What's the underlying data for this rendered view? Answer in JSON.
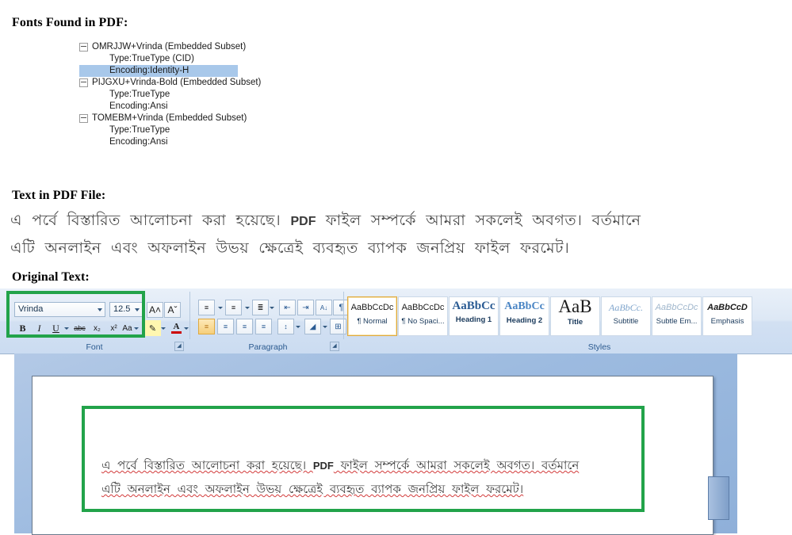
{
  "sections": {
    "fonts_heading": "Fonts Found in PDF:",
    "pdf_text_heading": "Text in PDF File:",
    "original_text_heading": "Original Text:"
  },
  "font_tree": [
    {
      "name": "OMRJJW+Vrinda (Embedded Subset)",
      "type": "Type:TrueType (CID)",
      "encoding": "Encoding:Identity-H",
      "encoding_selected": true
    },
    {
      "name": "PIJGXU+Vrinda-Bold (Embedded Subset)",
      "type": "Type:TrueType",
      "encoding": "Encoding:Ansi",
      "encoding_selected": false
    },
    {
      "name": "TOMEBM+Vrinda (Embedded Subset)",
      "type": "Type:TrueType",
      "encoding": "Encoding:Ansi",
      "encoding_selected": false
    }
  ],
  "pdf_text": {
    "line1_a": "এ পর্বে বিস্তারিত আলোচনা করা হয়েছে। ",
    "line1_latin": "PDF",
    "line1_b": " ফাইল সম্পর্কে আমরা সকলেই অবগত।  বর্তমানে",
    "line2": "এটি অনলাইন এবং অফলাইন উভয় ক্ষেত্রেই ব্যবহৃত ব্যাপক জনপ্রিয় ফাইল ফরমেট।"
  },
  "document_text": {
    "line1_a": "এ পর্বে বিস্তারিত আলোচনা করা হয়েছে। ",
    "line1_latin": "PDF",
    "line1_b": " ফাইল সম্পর্কে আমরা সকলেই অবগত।  বর্তমানে",
    "line2": "এটি অনলাইন এবং অফলাইন উভয় ক্ষেত্রেই ব্যবহৃত ব্যাপক জনপ্রিয় ফাইল ফরমেট।"
  },
  "ribbon": {
    "font_group": {
      "label": "Font",
      "font_name": "Vrinda",
      "font_size": "12.5",
      "buttons_row1": [
        {
          "name": "grow-font",
          "glyph": "A˄"
        },
        {
          "name": "shrink-font",
          "glyph": "Aˇ"
        },
        {
          "name": "clear-formatting",
          "glyph": "✐"
        }
      ],
      "buttons_row2": [
        {
          "name": "bold",
          "glyph": "B"
        },
        {
          "name": "italic",
          "glyph": "I"
        },
        {
          "name": "underline",
          "glyph": "U"
        },
        {
          "name": "strikethrough",
          "glyph": "abc"
        },
        {
          "name": "subscript",
          "glyph": "x₂"
        },
        {
          "name": "superscript",
          "glyph": "x²"
        },
        {
          "name": "change-case",
          "glyph": "Aa"
        },
        {
          "name": "text-highlight-color",
          "glyph": "✐"
        },
        {
          "name": "font-color",
          "glyph": "A"
        }
      ]
    },
    "paragraph_group": {
      "label": "Paragraph",
      "buttons_row1": [
        {
          "name": "bullets",
          "glyph": "☰"
        },
        {
          "name": "numbering",
          "glyph": "≡"
        },
        {
          "name": "multilevel-list",
          "glyph": "≣"
        },
        {
          "name": "decrease-indent",
          "glyph": "⇤"
        },
        {
          "name": "increase-indent",
          "glyph": "⇥"
        },
        {
          "name": "sort",
          "glyph": "A↓"
        },
        {
          "name": "show-formatting-marks",
          "glyph": "¶"
        }
      ],
      "buttons_row2": [
        {
          "name": "align-left",
          "glyph": "≡"
        },
        {
          "name": "align-center",
          "glyph": "≡"
        },
        {
          "name": "align-right",
          "glyph": "≡"
        },
        {
          "name": "justify",
          "glyph": "≡"
        },
        {
          "name": "line-spacing",
          "glyph": "↕"
        },
        {
          "name": "shading",
          "glyph": "◢"
        },
        {
          "name": "borders",
          "glyph": "⊞"
        }
      ]
    },
    "styles_group": {
      "label": "Styles",
      "tiles": [
        {
          "preview": "AaBbCcDc",
          "name": "¶ Normal",
          "active": true,
          "style": "normal"
        },
        {
          "preview": "AaBbCcDc",
          "name": "¶ No Spaci...",
          "active": false,
          "style": "normal"
        },
        {
          "preview": "AaBbCс",
          "name": "Heading 1",
          "active": false,
          "style": "heading1"
        },
        {
          "preview": "AaBbCc",
          "name": "Heading 2",
          "active": false,
          "style": "heading2"
        },
        {
          "preview": "AaB",
          "name": "Title",
          "active": false,
          "style": "title"
        },
        {
          "preview": "AaBbCc.",
          "name": "Subtitle",
          "active": false,
          "style": "subtitle"
        },
        {
          "preview": "AaBbCcDc",
          "name": "Subtle Em...",
          "active": false,
          "style": "subtle"
        },
        {
          "preview": "AaBbCcD",
          "name": "Emphasis",
          "active": false,
          "style": "emphasis"
        }
      ]
    }
  },
  "colors": {
    "highlight_selection": "#a8c8ea",
    "annotation_green": "#22a34a",
    "ribbon_blue": "#cbdcf1",
    "doc_canvas_blue": "#9dbbe0",
    "spell_error_red": "#d23b3b"
  }
}
